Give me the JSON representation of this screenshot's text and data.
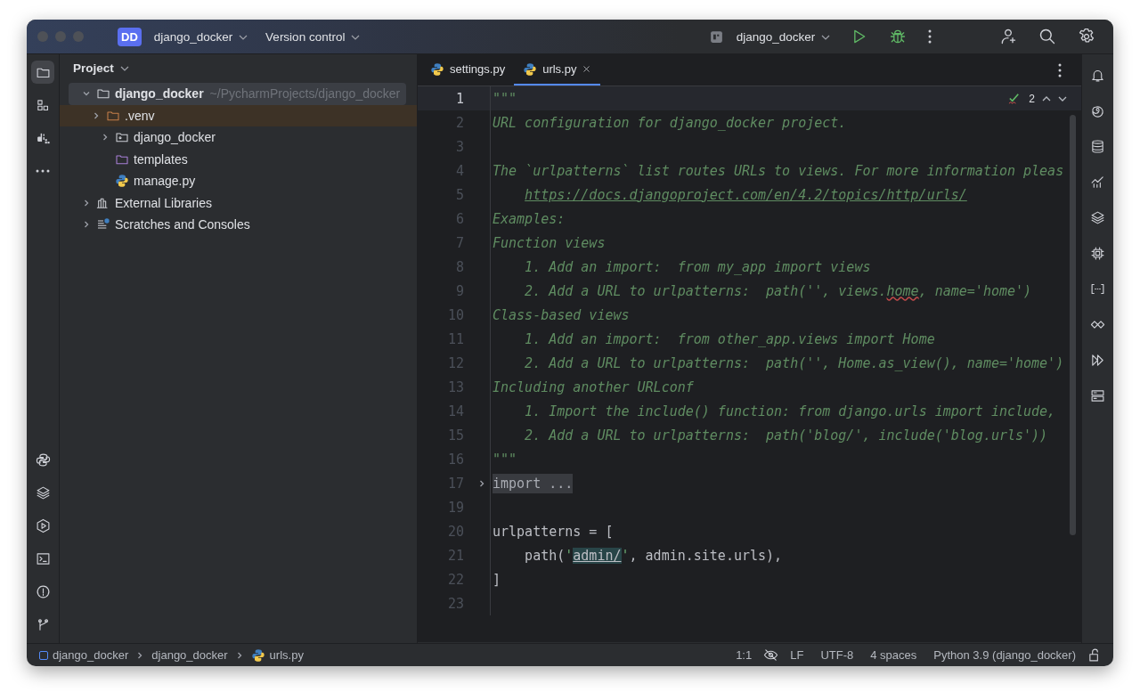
{
  "title_bar": {
    "project": {
      "initials": "DD",
      "name": "django_docker"
    },
    "vcs": "Version control",
    "run_config": "django_docker"
  },
  "project_panel": {
    "title": "Project",
    "tree": [
      {
        "name": "django_docker",
        "path": "~/PycharmProjects/django_docker",
        "kind": "folder",
        "expanded": true,
        "selected": true,
        "children": [
          {
            "name": ".venv",
            "kind": "excluded",
            "expanded": false,
            "selected": false
          },
          {
            "name": "django_docker",
            "kind": "package",
            "expanded": false,
            "selected": false
          },
          {
            "name": "templates",
            "kind": "templates",
            "selected": false
          },
          {
            "name": "manage.py",
            "kind": "python",
            "selected": false
          }
        ]
      },
      {
        "name": "External Libraries",
        "kind": "libraries",
        "expanded": false,
        "selected": false
      },
      {
        "name": "Scratches and Consoles",
        "kind": "scratches",
        "expanded": false,
        "selected": false
      }
    ]
  },
  "tabs": [
    {
      "label": "settings.py",
      "selected": false
    },
    {
      "label": "urls.py",
      "selected": true
    }
  ],
  "editor": {
    "inspections": "2",
    "lines": [
      {
        "number": "1",
        "current": true,
        "segments": [
          {
            "kind": "doc",
            "text": "\"\"\""
          }
        ]
      },
      {
        "number": "2",
        "current": false,
        "segments": [
          {
            "kind": "doc",
            "text": "URL configuration for django_docker project."
          }
        ]
      },
      {
        "number": "3",
        "current": false
      },
      {
        "number": "4",
        "current": false,
        "segments": [
          {
            "kind": "doc",
            "text": "The `urlpatterns` list routes URLs to views. For more information pleas"
          }
        ]
      },
      {
        "number": "5",
        "current": false,
        "segments": [
          {
            "kind": "link",
            "text": "https://docs.djangoproject.com/en/4.2/topics/http/urls/"
          }
        ]
      },
      {
        "number": "6",
        "current": false,
        "segments": [
          {
            "kind": "doc",
            "text": "Examples:"
          }
        ]
      },
      {
        "number": "7",
        "current": false,
        "segments": [
          {
            "kind": "doc",
            "text": "Function views"
          }
        ]
      },
      {
        "number": "8",
        "current": false,
        "segments": [
          {
            "kind": "doc",
            "text": "    1. Add an import:  from my_app import views"
          }
        ]
      },
      {
        "number": "9",
        "current": false,
        "segments": [
          {
            "kind": "doc",
            "text": "    2. Add a URL to urlpatterns:  path('', views."
          },
          {
            "kind": "typo",
            "text": "home"
          },
          {
            "kind": "doc",
            "text": ", name='home')"
          }
        ]
      },
      {
        "number": "10",
        "current": false,
        "segments": [
          {
            "kind": "doc",
            "text": "Class-based views"
          }
        ]
      },
      {
        "number": "11",
        "current": false,
        "segments": [
          {
            "kind": "doc",
            "text": "    1. Add an import:  from other_app.views import Home"
          }
        ]
      },
      {
        "number": "12",
        "current": false,
        "segments": [
          {
            "kind": "doc",
            "text": "    2. Add a URL to urlpatterns:  path('', Home.as_view(), name='home')"
          }
        ]
      },
      {
        "number": "13",
        "current": false,
        "segments": [
          {
            "kind": "doc",
            "text": "Including another URLconf"
          }
        ]
      },
      {
        "number": "14",
        "current": false,
        "segments": [
          {
            "kind": "doc",
            "text": "    1. Import the include() function: from django.urls import include,"
          }
        ]
      },
      {
        "number": "15",
        "current": false,
        "segments": [
          {
            "kind": "doc",
            "text": "    2. Add a URL to urlpatterns:  path('blog/', include('blog.urls'))"
          }
        ]
      },
      {
        "number": "16",
        "current": false,
        "segments": [
          {
            "kind": "doc",
            "text": "\"\"\""
          }
        ]
      },
      {
        "number": "17",
        "current": false,
        "segments": [
          {
            "kind": "fold",
            "text": "import ..."
          }
        ]
      },
      {
        "number": "19",
        "current": false
      },
      {
        "number": "20",
        "current": false,
        "segments": [
          {
            "kind": "code",
            "text": "urlpatterns = ["
          }
        ]
      },
      {
        "number": "21",
        "current": false,
        "segments": [
          {
            "kind": "code",
            "text": "    path("
          },
          {
            "kind": "string",
            "text": "'"
          },
          {
            "kind": "match",
            "text": "admin/"
          },
          {
            "kind": "string",
            "text": "'"
          },
          {
            "kind": "code",
            "text": ", admin.site.urls),"
          }
        ]
      },
      {
        "number": "22",
        "current": false,
        "segments": [
          {
            "kind": "code",
            "text": "]"
          }
        ]
      },
      {
        "number": "23",
        "current": false
      }
    ]
  },
  "status_bar": {
    "breadcrumbs": [
      {
        "label": "django_docker",
        "kind": "module"
      },
      {
        "label": "django_docker",
        "kind": "folder"
      },
      {
        "label": "urls.py",
        "kind": "python"
      }
    ],
    "position": "1:1",
    "line_separator": "LF",
    "encoding": "UTF-8",
    "indent": "4 spaces",
    "interpreter": "Python 3.9 (django_docker)"
  }
}
